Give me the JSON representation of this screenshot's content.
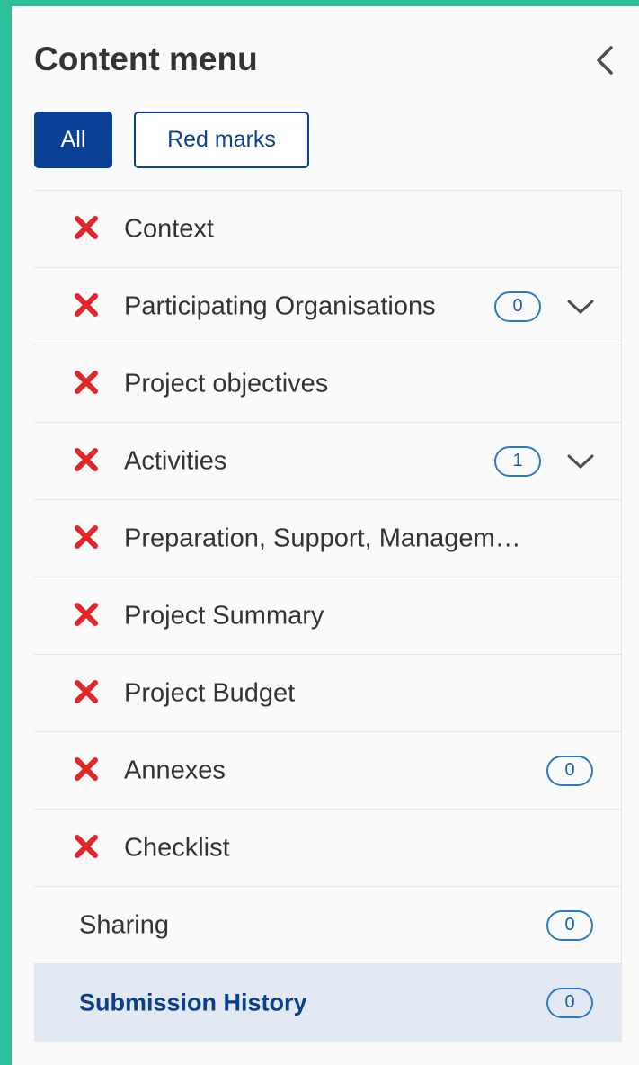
{
  "header": {
    "title": "Content menu"
  },
  "filters": {
    "all_label": "All",
    "red_marks_label": "Red marks"
  },
  "colors": {
    "accent": "#0b4194",
    "error_mark": "#e0252b",
    "badge_border": "#2a7bc7",
    "active_bg": "#e2e9f3",
    "frame": "#2fbf99"
  },
  "menu": {
    "items": [
      {
        "label": "Context",
        "status_icon": "x-mark-icon"
      },
      {
        "label": "Participating Organisations",
        "status_icon": "x-mark-icon",
        "badge": "0",
        "expandable": true
      },
      {
        "label": "Project objectives",
        "status_icon": "x-mark-icon"
      },
      {
        "label": "Activities",
        "status_icon": "x-mark-icon",
        "badge": "1",
        "expandable": true
      },
      {
        "label": "Preparation, Support, Managem…",
        "status_icon": "x-mark-icon"
      },
      {
        "label": "Project Summary",
        "status_icon": "x-mark-icon"
      },
      {
        "label": "Project Budget",
        "status_icon": "x-mark-icon"
      },
      {
        "label": "Annexes",
        "status_icon": "x-mark-icon",
        "badge": "0"
      },
      {
        "label": "Checklist",
        "status_icon": "x-mark-icon"
      },
      {
        "label": "Sharing",
        "badge": "0"
      },
      {
        "label": "Submission History",
        "badge": "0",
        "active": true
      }
    ]
  }
}
